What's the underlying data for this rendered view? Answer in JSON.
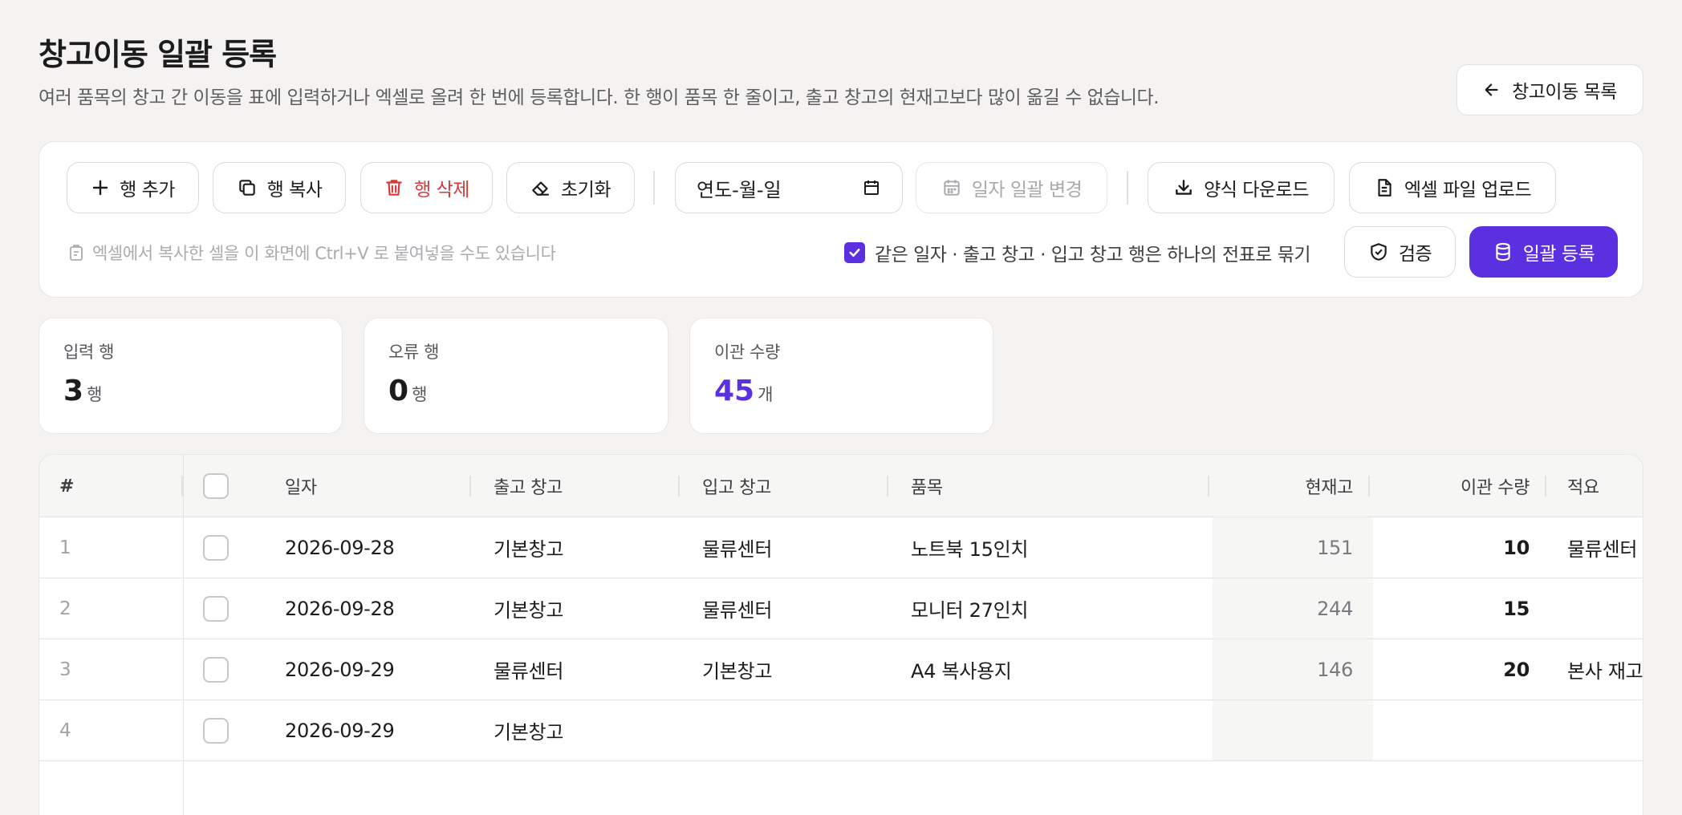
{
  "header": {
    "title": "창고이동 일괄 등록",
    "description": "여러 품목의 창고 간 이동을 표에 입력하거나 엑셀로 올려 한 번에 등록합니다. 한 행이 품목 한 줄이고, 출고 창고의 현재고보다 많이 옮길 수 없습니다.",
    "back_label": "창고이동 목록"
  },
  "toolbar": {
    "add_row": "행 추가",
    "copy_row": "행 복사",
    "delete_row": "행 삭제",
    "reset": "초기화",
    "date_placeholder": "연도-월-일",
    "bulk_date_change": "일자 일괄 변경",
    "download_template": "양식 다운로드",
    "upload_excel": "엑셀 파일 업로드",
    "paste_hint": "엑셀에서 복사한 셀을 이 화면에 Ctrl+V 로 붙여넣을 수도 있습니다",
    "group_option": "같은 일자 · 출고 창고 · 입고 창고 행은 하나의 전표로 묶기",
    "group_option_checked": true,
    "validate": "검증",
    "submit": "일괄 등록"
  },
  "stats": [
    {
      "label": "입력 행",
      "value": "3",
      "unit": "행"
    },
    {
      "label": "오류 행",
      "value": "0",
      "unit": "행"
    },
    {
      "label": "이관 수량",
      "value": "45",
      "unit": "개"
    }
  ],
  "table": {
    "headers": {
      "num": "#",
      "date": "일자",
      "from": "출고 창고",
      "to": "입고 창고",
      "item": "품목",
      "stock": "현재고",
      "qty": "이관 수량",
      "memo": "적요"
    },
    "rows": [
      {
        "num": "1",
        "date": "2026-09-28",
        "from": "기본창고",
        "to": "물류센터",
        "item": "노트북 15인치",
        "stock": "151",
        "qty": "10",
        "memo": "물류센터"
      },
      {
        "num": "2",
        "date": "2026-09-28",
        "from": "기본창고",
        "to": "물류센터",
        "item": "모니터 27인치",
        "stock": "244",
        "qty": "15",
        "memo": ""
      },
      {
        "num": "3",
        "date": "2026-09-29",
        "from": "물류센터",
        "to": "기본창고",
        "item": "A4 복사용지",
        "stock": "146",
        "qty": "20",
        "memo": "본사 재고"
      },
      {
        "num": "4",
        "date": "2026-09-29",
        "from": "기본창고",
        "to": "",
        "item": "",
        "stock": "",
        "qty": "",
        "memo": ""
      }
    ]
  },
  "colors": {
    "accent": "#5b30e0",
    "danger": "#d6393a"
  }
}
